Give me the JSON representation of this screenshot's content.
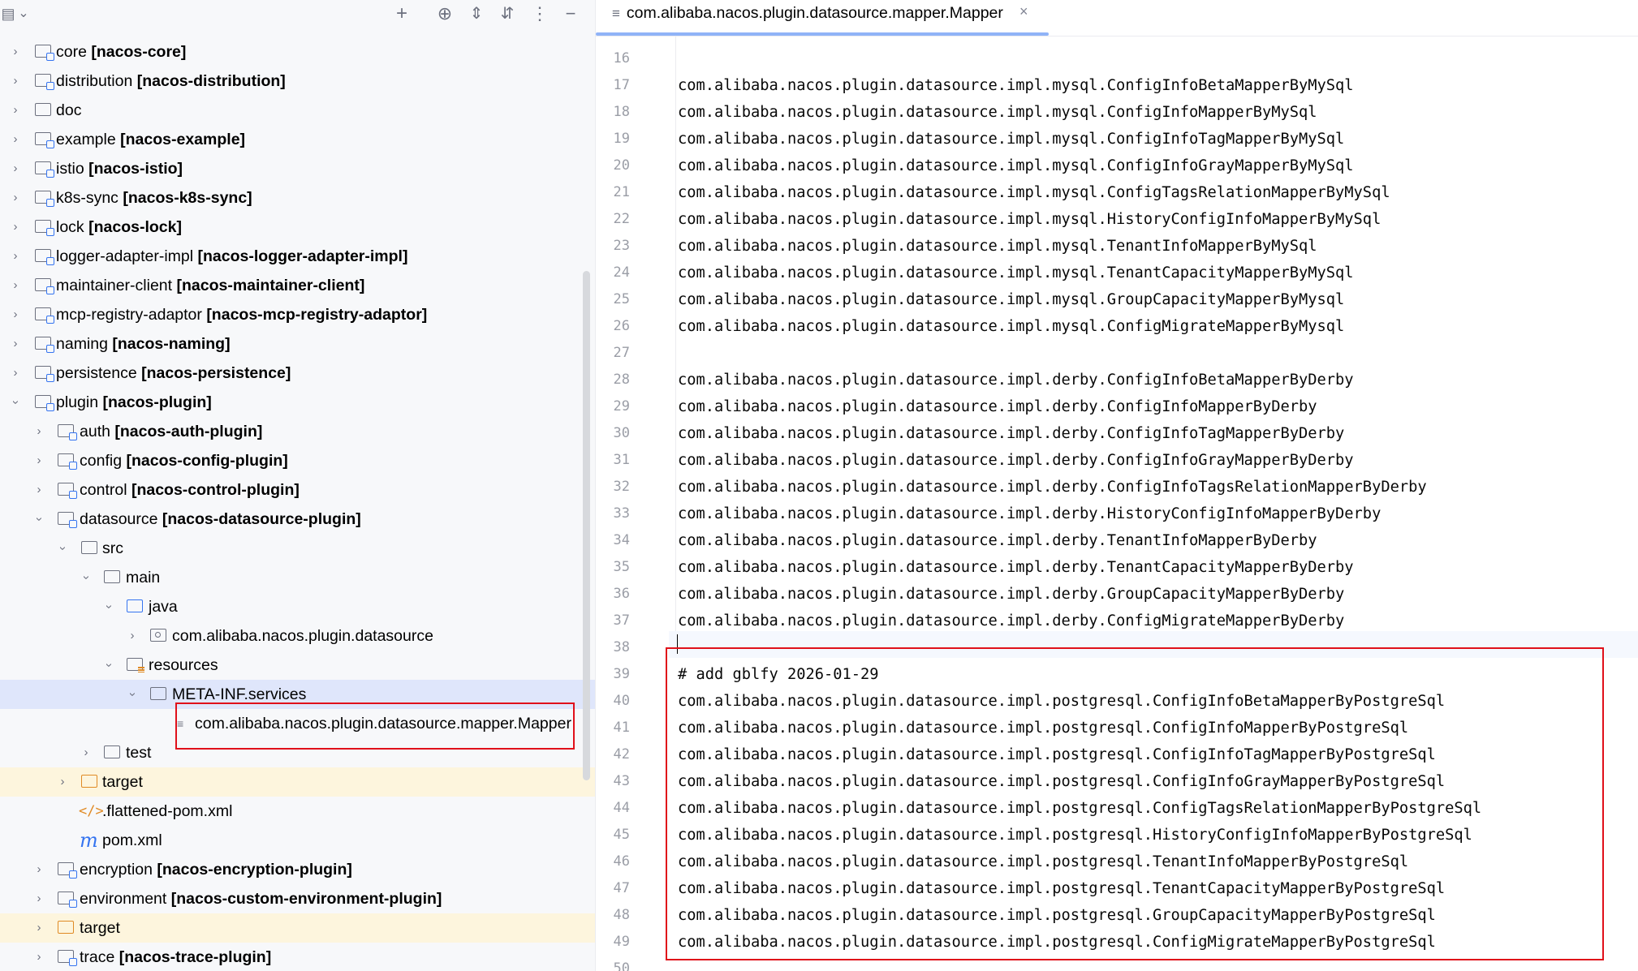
{
  "toolbar": {
    "icons": [
      "project-icon",
      "chevron-down-icon",
      "add-icon",
      "locate-icon",
      "expand-icon",
      "collapse-icon",
      "more-icon",
      "hide-icon"
    ]
  },
  "tree": {
    "rows": [
      {
        "name": "core",
        "module": "[nacos-core]"
      },
      {
        "name": "distribution",
        "module": "[nacos-distribution]"
      },
      {
        "name": "doc",
        "module": ""
      },
      {
        "name": "example",
        "module": "[nacos-example]"
      },
      {
        "name": "istio",
        "module": "[nacos-istio]"
      },
      {
        "name": "k8s-sync",
        "module": "[nacos-k8s-sync]"
      },
      {
        "name": "lock",
        "module": "[nacos-lock]"
      },
      {
        "name": "logger-adapter-impl",
        "module": "[nacos-logger-adapter-impl]"
      },
      {
        "name": "maintainer-client",
        "module": "[nacos-maintainer-client]"
      },
      {
        "name": "mcp-registry-adaptor",
        "module": "[nacos-mcp-registry-adaptor]"
      },
      {
        "name": "naming",
        "module": "[nacos-naming]"
      },
      {
        "name": "persistence",
        "module": "[nacos-persistence]"
      },
      {
        "name": "plugin",
        "module": "[nacos-plugin]"
      },
      {
        "name": "auth",
        "module": "[nacos-auth-plugin]"
      },
      {
        "name": "config",
        "module": "[nacos-config-plugin]"
      },
      {
        "name": "control",
        "module": "[nacos-control-plugin]"
      },
      {
        "name": "datasource",
        "module": "[nacos-datasource-plugin]"
      },
      {
        "name": "src",
        "module": ""
      },
      {
        "name": "main",
        "module": ""
      },
      {
        "name": "java",
        "module": ""
      },
      {
        "name": "com.alibaba.nacos.plugin.datasource",
        "module": ""
      },
      {
        "name": "resources",
        "module": ""
      },
      {
        "name": "META-INF.services",
        "module": ""
      },
      {
        "name": "com.alibaba.nacos.plugin.datasource.mapper.Mapper",
        "module": ""
      },
      {
        "name": "test",
        "module": ""
      },
      {
        "name": "target",
        "module": ""
      },
      {
        "name": ".flattened-pom.xml",
        "module": ""
      },
      {
        "name": "pom.xml",
        "module": ""
      },
      {
        "name": "encryption",
        "module": "[nacos-encryption-plugin]"
      },
      {
        "name": "environment",
        "module": "[nacos-custom-environment-plugin]"
      },
      {
        "name": "target",
        "module": ""
      },
      {
        "name": "trace",
        "module": "[nacos-trace-plugin]"
      }
    ]
  },
  "editor": {
    "tab_title": "com.alibaba.nacos.plugin.datasource.mapper.Mapper",
    "lines": [
      {
        "n": "16",
        "text": ""
      },
      {
        "n": "17",
        "text": "com.alibaba.nacos.plugin.datasource.impl.mysql.ConfigInfoBetaMapperByMySql"
      },
      {
        "n": "18",
        "text": "com.alibaba.nacos.plugin.datasource.impl.mysql.ConfigInfoMapperByMySql"
      },
      {
        "n": "19",
        "text": "com.alibaba.nacos.plugin.datasource.impl.mysql.ConfigInfoTagMapperByMySql"
      },
      {
        "n": "20",
        "text": "com.alibaba.nacos.plugin.datasource.impl.mysql.ConfigInfoGrayMapperByMySql"
      },
      {
        "n": "21",
        "text": "com.alibaba.nacos.plugin.datasource.impl.mysql.ConfigTagsRelationMapperByMySql"
      },
      {
        "n": "22",
        "text": "com.alibaba.nacos.plugin.datasource.impl.mysql.HistoryConfigInfoMapperByMySql"
      },
      {
        "n": "23",
        "text": "com.alibaba.nacos.plugin.datasource.impl.mysql.TenantInfoMapperByMySql"
      },
      {
        "n": "24",
        "text": "com.alibaba.nacos.plugin.datasource.impl.mysql.TenantCapacityMapperByMySql"
      },
      {
        "n": "25",
        "text": "com.alibaba.nacos.plugin.datasource.impl.mysql.GroupCapacityMapperByMysql"
      },
      {
        "n": "26",
        "text": "com.alibaba.nacos.plugin.datasource.impl.mysql.ConfigMigrateMapperByMysql"
      },
      {
        "n": "27",
        "text": ""
      },
      {
        "n": "28",
        "text": "com.alibaba.nacos.plugin.datasource.impl.derby.ConfigInfoBetaMapperByDerby"
      },
      {
        "n": "29",
        "text": "com.alibaba.nacos.plugin.datasource.impl.derby.ConfigInfoMapperByDerby"
      },
      {
        "n": "30",
        "text": "com.alibaba.nacos.plugin.datasource.impl.derby.ConfigInfoTagMapperByDerby"
      },
      {
        "n": "31",
        "text": "com.alibaba.nacos.plugin.datasource.impl.derby.ConfigInfoGrayMapperByDerby"
      },
      {
        "n": "32",
        "text": "com.alibaba.nacos.plugin.datasource.impl.derby.ConfigInfoTagsRelationMapperByDerby"
      },
      {
        "n": "33",
        "text": "com.alibaba.nacos.plugin.datasource.impl.derby.HistoryConfigInfoMapperByDerby"
      },
      {
        "n": "34",
        "text": "com.alibaba.nacos.plugin.datasource.impl.derby.TenantInfoMapperByDerby"
      },
      {
        "n": "35",
        "text": "com.alibaba.nacos.plugin.datasource.impl.derby.TenantCapacityMapperByDerby"
      },
      {
        "n": "36",
        "text": "com.alibaba.nacos.plugin.datasource.impl.derby.GroupCapacityMapperByDerby"
      },
      {
        "n": "37",
        "text": "com.alibaba.nacos.plugin.datasource.impl.derby.ConfigMigrateMapperByDerby"
      },
      {
        "n": "38",
        "text": ""
      },
      {
        "n": "39",
        "text": "# add gblfy 2026-01-29"
      },
      {
        "n": "40",
        "text": "com.alibaba.nacos.plugin.datasource.impl.postgresql.ConfigInfoBetaMapperByPostgreSql"
      },
      {
        "n": "41",
        "text": "com.alibaba.nacos.plugin.datasource.impl.postgresql.ConfigInfoMapperByPostgreSql"
      },
      {
        "n": "42",
        "text": "com.alibaba.nacos.plugin.datasource.impl.postgresql.ConfigInfoTagMapperByPostgreSql"
      },
      {
        "n": "43",
        "text": "com.alibaba.nacos.plugin.datasource.impl.postgresql.ConfigInfoGrayMapperByPostgreSql"
      },
      {
        "n": "44",
        "text": "com.alibaba.nacos.plugin.datasource.impl.postgresql.ConfigTagsRelationMapperByPostgreSql"
      },
      {
        "n": "45",
        "text": "com.alibaba.nacos.plugin.datasource.impl.postgresql.HistoryConfigInfoMapperByPostgreSql"
      },
      {
        "n": "46",
        "text": "com.alibaba.nacos.plugin.datasource.impl.postgresql.TenantInfoMapperByPostgreSql"
      },
      {
        "n": "47",
        "text": "com.alibaba.nacos.plugin.datasource.impl.postgresql.TenantCapacityMapperByPostgreSql"
      },
      {
        "n": "48",
        "text": "com.alibaba.nacos.plugin.datasource.impl.postgresql.GroupCapacityMapperByPostgreSql"
      },
      {
        "n": "49",
        "text": "com.alibaba.nacos.plugin.datasource.impl.postgresql.ConfigMigrateMapperByPostgreSql"
      },
      {
        "n": "50",
        "text": ""
      }
    ]
  },
  "colors": {
    "highlight_border": "#e0101a",
    "selection": "#dfe6fb",
    "excluded": "#fdf5dd",
    "accent": "#3574f0"
  }
}
